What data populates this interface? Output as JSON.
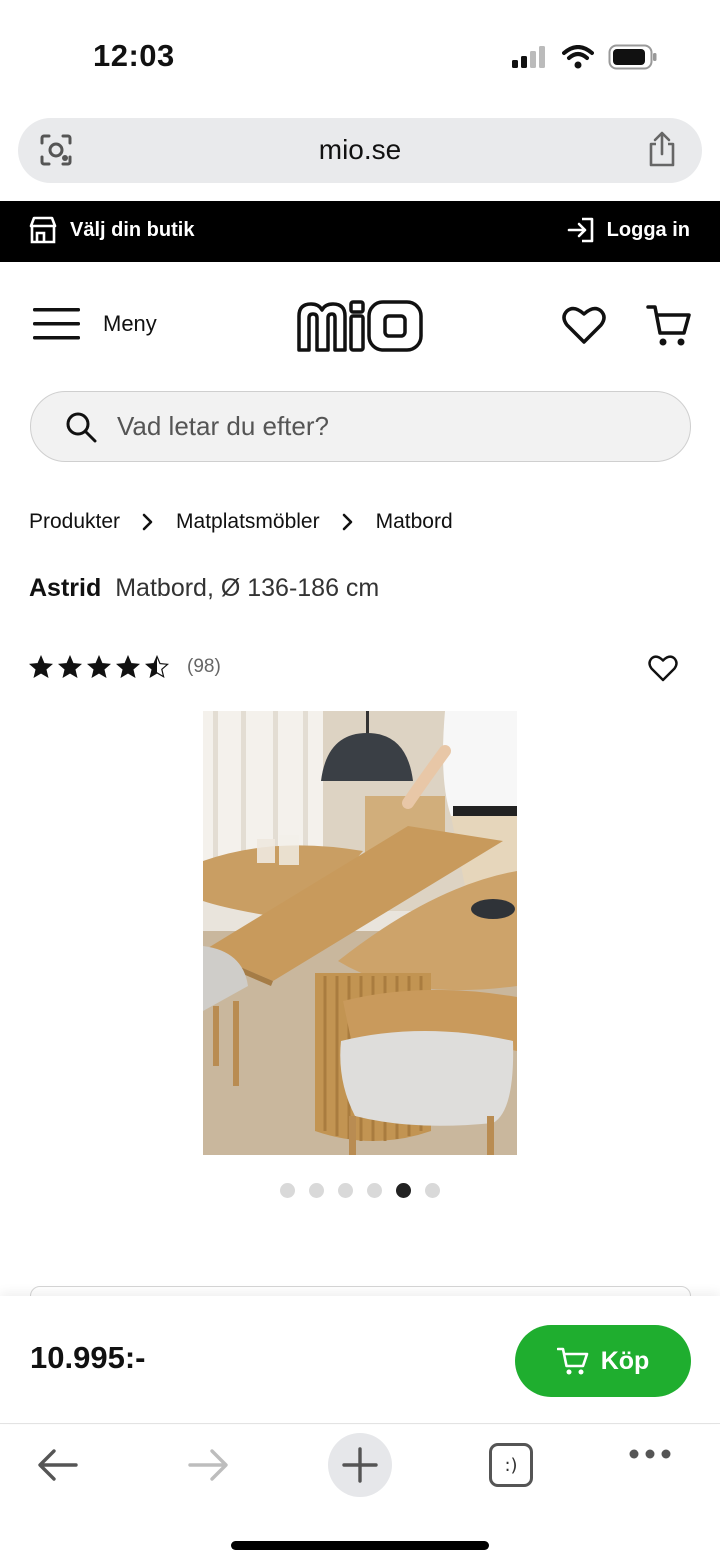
{
  "status_bar": {
    "time": "12:03"
  },
  "browser": {
    "url": "mio.se"
  },
  "top_strip": {
    "store_label": "Välj din butik",
    "login_label": "Logga in"
  },
  "header": {
    "menu_label": "Meny",
    "logo_text": "mio"
  },
  "search": {
    "placeholder": "Vad letar du efter?"
  },
  "breadcrumb": {
    "items": [
      "Produkter",
      "Matplatsmöbler",
      "Matbord"
    ]
  },
  "product": {
    "name": "Astrid",
    "description": "Matbord, Ø 136-186 cm",
    "rating": 4.5,
    "review_count": "(98)",
    "carousel": {
      "total": 6,
      "active_index": 4
    }
  },
  "buy_bar": {
    "price": "10.995:-",
    "buy_label": "Köp",
    "accent_color": "#1fae2f"
  },
  "icons": [
    "camera-lens-icon",
    "share-icon",
    "store-icon",
    "login-icon",
    "hamburger-icon",
    "heart-icon",
    "cart-icon",
    "search-icon",
    "star-icon",
    "back-icon",
    "forward-icon",
    "plus-icon",
    "tabs-icon",
    "more-icon"
  ]
}
